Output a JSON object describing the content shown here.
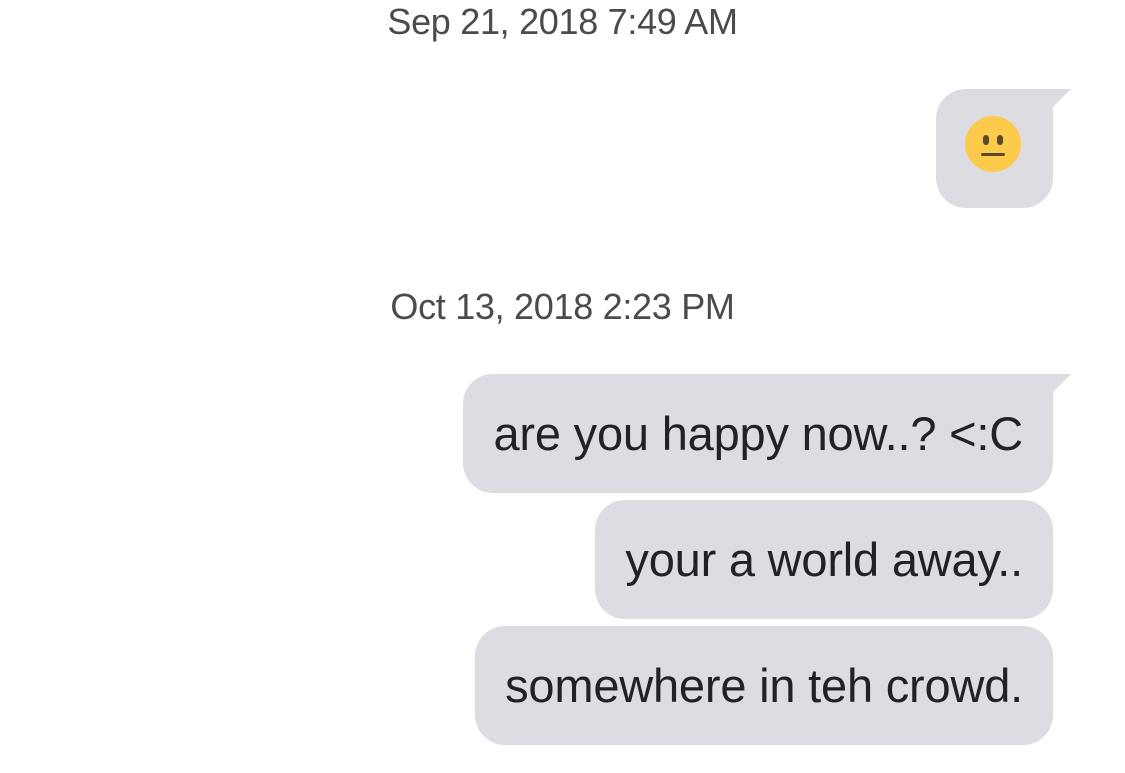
{
  "conversation": {
    "groups": [
      {
        "timestamp": "Sep 21, 2018 7:49 AM",
        "messages": [
          {
            "type": "emoji",
            "icon": "neutral-face-emoji",
            "emoji_color": "#fccb4c"
          }
        ]
      },
      {
        "timestamp": "Oct 13, 2018 2:23 PM",
        "messages": [
          {
            "type": "text",
            "text": "are you happy now..? <:C"
          },
          {
            "type": "text",
            "text": "your a world away.."
          },
          {
            "type": "text",
            "text": "somewhere in teh crowd."
          }
        ]
      }
    ]
  },
  "colors": {
    "bubble_bg": "#dcdce2",
    "bubble_text": "#222226",
    "timestamp_text": "#4a4a50",
    "background": "#ffffff"
  }
}
